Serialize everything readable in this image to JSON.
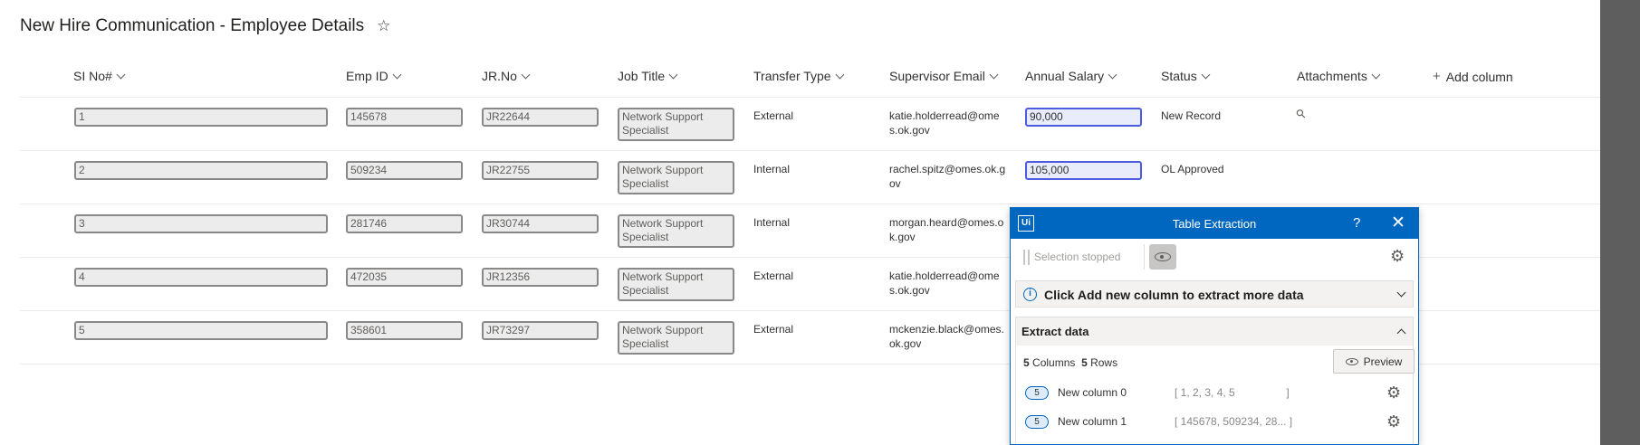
{
  "page": {
    "title": "New Hire Communication - Employee Details",
    "star_icon": "star-outline-icon"
  },
  "columns": [
    {
      "label": "SI No#"
    },
    {
      "label": "Emp ID"
    },
    {
      "label": "JR.No"
    },
    {
      "label": "Job Title"
    },
    {
      "label": "Transfer Type"
    },
    {
      "label": "Supervisor Email"
    },
    {
      "label": "Annual Salary"
    },
    {
      "label": "Status"
    },
    {
      "label": "Attachments"
    }
  ],
  "add_column_label": "Add column",
  "rows": [
    {
      "si": "1",
      "emp_id": "145678",
      "jr": "JR22644",
      "job_title": "Network Support Specialist",
      "transfer": "External",
      "email": "katie.holderread@omes.ok.gov",
      "salary": "90,000",
      "status": "New Record",
      "has_attachment": true
    },
    {
      "si": "2",
      "emp_id": "509234",
      "jr": "JR22755",
      "job_title": "Network Support Specialist",
      "transfer": "Internal",
      "email": "rachel.spitz@omes.ok.gov",
      "salary": "105,000",
      "status": "OL Approved",
      "has_attachment": false
    },
    {
      "si": "3",
      "emp_id": "281746",
      "jr": "JR30744",
      "job_title": "Network Support Specialist",
      "transfer": "Internal",
      "email": "morgan.heard@omes.ok.gov",
      "salary": "",
      "status": "",
      "has_attachment": false
    },
    {
      "si": "4",
      "emp_id": "472035",
      "jr": "JR12356",
      "job_title": "Network Support Specialist",
      "transfer": "External",
      "email": "katie.holderread@omes.ok.gov",
      "salary": "",
      "status": "",
      "has_attachment": false
    },
    {
      "si": "5",
      "emp_id": "358601",
      "jr": "JR73297",
      "job_title": "Network Support Specialist",
      "transfer": "External",
      "email": "mckenzie.black@omes.ok.gov",
      "salary": "",
      "status": "",
      "has_attachment": false
    }
  ],
  "panel": {
    "logo": "Ui",
    "title": "Table Extraction",
    "help": "?",
    "close": "✕",
    "selection_status": "Selection stopped",
    "info_text": "Click Add new column to extract more data",
    "extract_title": "Extract data",
    "columns_count": "5",
    "columns_word": "Columns",
    "rows_count": "5",
    "rows_word": "Rows",
    "preview_label": "Preview",
    "extracted_columns": [
      {
        "count": "5",
        "name": "New column 0",
        "values": "[ 1, 2, 3, 4, 5                 ]"
      },
      {
        "count": "5",
        "name": "New column 1",
        "values": "[ 145678, 509234, 28... ]"
      }
    ],
    "colors": {
      "header": "#0067c0",
      "highlight": "#4d5be0"
    }
  }
}
